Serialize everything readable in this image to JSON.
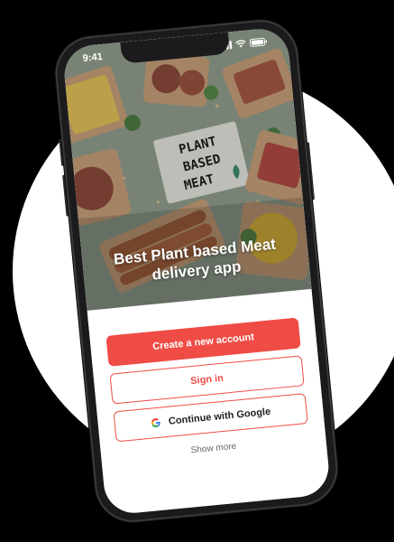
{
  "colors": {
    "accent": "#ee4c45",
    "page_background": "#000000",
    "circle": "#ffffff"
  },
  "status_bar": {
    "time": "9:41",
    "icons": [
      "cellular-signal-icon",
      "wifi-icon",
      "battery-icon"
    ]
  },
  "hero": {
    "sign_lines": [
      "PLANT",
      "BASED",
      "MEAT"
    ],
    "headline": "Best Plant based Meat delivery app"
  },
  "actions": {
    "create_account": "Create a new account",
    "sign_in": "Sign in",
    "google": "Continue with Google",
    "google_icon": "google-g-icon",
    "show_more": "Show more"
  }
}
